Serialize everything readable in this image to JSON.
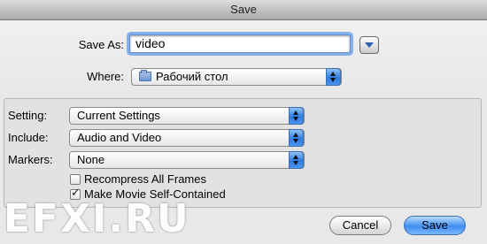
{
  "window": {
    "title": "Save"
  },
  "save_as": {
    "label": "Save As:",
    "value": "video"
  },
  "where": {
    "label": "Where:",
    "value": "Рабочий стол"
  },
  "options": {
    "setting": {
      "label": "Setting:",
      "value": "Current Settings"
    },
    "include": {
      "label": "Include:",
      "value": "Audio and Video"
    },
    "markers": {
      "label": "Markers:",
      "value": "None"
    },
    "recompress": {
      "label": "Recompress All Frames",
      "checked": false
    },
    "self_contained": {
      "label": "Make Movie Self-Contained",
      "checked": true
    }
  },
  "watermark": "EFXI.RU",
  "buttons": {
    "cancel": "Cancel",
    "save": "Save"
  },
  "colors": {
    "accent": "#3f8ef0",
    "titlebar": "#a9a9a9"
  }
}
